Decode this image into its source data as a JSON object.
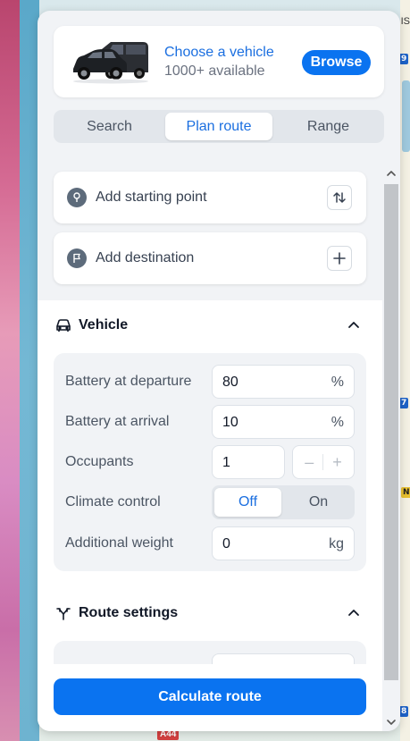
{
  "vehicle_picker": {
    "title": "Choose a vehicle",
    "subtitle": "1000+ available",
    "browse_label": "Browse"
  },
  "tabs": [
    {
      "label": "Search",
      "active": false
    },
    {
      "label": "Plan route",
      "active": true
    },
    {
      "label": "Range",
      "active": false
    }
  ],
  "route": {
    "start_placeholder": "Add starting point",
    "destination_placeholder": "Add destination"
  },
  "vehicle_section": {
    "title": "Vehicle",
    "battery_departure": {
      "label": "Battery at departure",
      "value": "80",
      "unit": "%"
    },
    "battery_arrival": {
      "label": "Battery at arrival",
      "value": "10",
      "unit": "%"
    },
    "occupants": {
      "label": "Occupants",
      "value": "1",
      "minus": "–",
      "plus": "+"
    },
    "climate": {
      "label": "Climate control",
      "off": "Off",
      "on": "On",
      "selected": "Off"
    },
    "additional_weight": {
      "label": "Additional weight",
      "value": "0",
      "unit": "kg"
    }
  },
  "route_settings": {
    "title": "Route settings"
  },
  "footer": {
    "calculate_label": "Calculate route"
  },
  "map": {
    "road_label": "A44",
    "edge_text": "IS",
    "signs": [
      "9",
      "7",
      "N",
      "8"
    ]
  },
  "colors": {
    "accent": "#0a73f0",
    "panel_bg": "#f1f3f6",
    "card_bg": "#ffffff"
  }
}
